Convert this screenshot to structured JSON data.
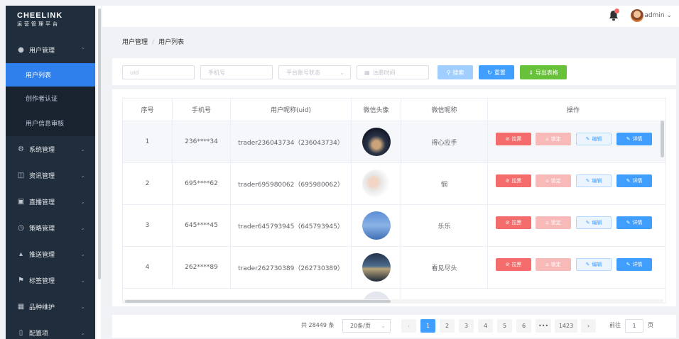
{
  "sidebar": {
    "brand": "CHEELINK",
    "brand_sub": "运营管理平台",
    "user_management": "用户管理",
    "user_list": "用户列表",
    "creator_cert": "创作者认证",
    "user_info_review": "用户信息审核",
    "system": "系统管理",
    "news": "资讯管理",
    "live": "直播管理",
    "strategy": "策略管理",
    "push": "推送管理",
    "tags": "标签管理",
    "variety": "品种维护",
    "config": "配置项"
  },
  "header": {
    "user_name": "admin"
  },
  "breadcrumb": {
    "root": "用户管理",
    "sep": "/",
    "current": "用户列表"
  },
  "filters": {
    "uid_placeholder": "uid",
    "phone_placeholder": "手机号",
    "status_placeholder": "平台账号状态",
    "date_placeholder": "注册时间",
    "search_label": "搜索",
    "reset_label": "重置",
    "export_label": "导出表格"
  },
  "table": {
    "headers": {
      "index": "序号",
      "phone": "手机号",
      "nickname": "用户昵称(uid)",
      "wx_avatar": "微信头像",
      "wx_name": "微信昵称",
      "ops": "操作"
    },
    "ops": {
      "blacklist": "拉黑",
      "lock": "锁定",
      "edit": "编辑",
      "detail": "详情"
    },
    "rows": [
      {
        "index": "1",
        "phone": "236****34",
        "nickname": "trader236043734（236043734）",
        "wx_name": "得心应手"
      },
      {
        "index": "2",
        "phone": "695****62",
        "nickname": "trader695980062（695980062）",
        "wx_name": "悯"
      },
      {
        "index": "3",
        "phone": "645****45",
        "nickname": "trader645793945（645793945）",
        "wx_name": "乐乐"
      },
      {
        "index": "4",
        "phone": "262****89",
        "nickname": "trader262730389（262730389）",
        "wx_name": "看见尽头"
      }
    ]
  },
  "pagination": {
    "total": "共 28449 条",
    "page_size": "20条/页",
    "pages": [
      "1",
      "2",
      "3",
      "4",
      "5",
      "6",
      "•••",
      "1423"
    ],
    "goto_label": "前往",
    "goto_value": "1",
    "page_unit": "页"
  },
  "colors": {
    "primary": "#409eff",
    "danger": "#f56c6c",
    "success": "#67c23a",
    "sidebar": "#1f2d3d",
    "active": "#2f80ed"
  }
}
